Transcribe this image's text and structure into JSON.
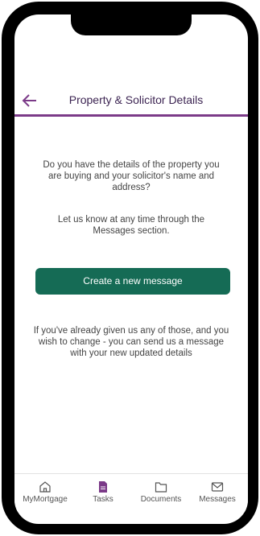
{
  "header": {
    "title": "Property & Solicitor Details",
    "back_icon": "arrow-left-icon"
  },
  "main": {
    "question": "Do you have the details of the property you are buying and your solicitor's name and address?",
    "let_us_know": "Let us know at any time through the Messages section.",
    "cta_label": "Create a new message",
    "already_given": "If you've already given us any of those, and you wish to change - you can send us a message with your new updated details"
  },
  "tabbar": {
    "items": [
      {
        "label": "MyMortgage",
        "icon": "home-icon",
        "active": false
      },
      {
        "label": "Tasks",
        "icon": "document-icon",
        "active": true
      },
      {
        "label": "Documents",
        "icon": "folder-icon",
        "active": false
      },
      {
        "label": "Messages",
        "icon": "mail-icon",
        "active": false
      }
    ]
  },
  "colors": {
    "accent": "#7b3a88",
    "button": "#156b55",
    "title_text": "#3c2452"
  }
}
